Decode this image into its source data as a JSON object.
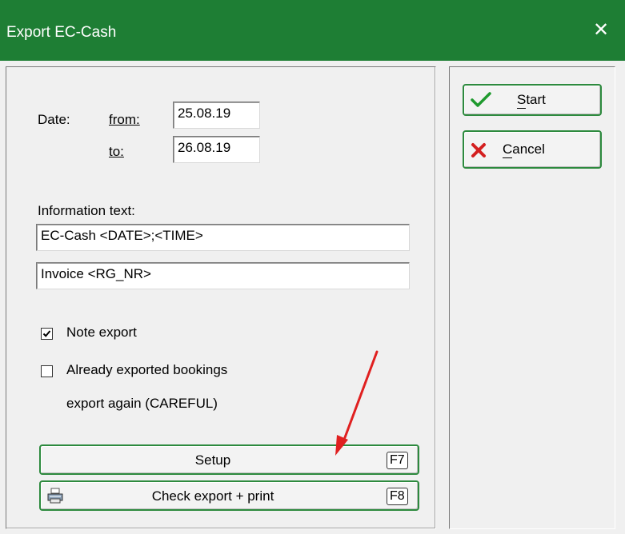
{
  "window": {
    "title": "Export EC-Cash"
  },
  "date": {
    "label": "Date:",
    "from_label": "from:",
    "to_label": "to:",
    "from_value": "25.08.19",
    "to_value": "26.08.19"
  },
  "info": {
    "label": "Information text:",
    "line1": "EC-Cash <DATE>;<TIME>",
    "line2": "Invoice <RG_NR>"
  },
  "options": {
    "note_export": {
      "label": "Note export",
      "checked": true
    },
    "already_exported": {
      "label_line1": "Already exported bookings",
      "label_line2": "export again (CAREFUL)",
      "checked": false
    }
  },
  "buttons": {
    "setup": {
      "label": "Setup",
      "key": "F7"
    },
    "check": {
      "label": "Check export + print",
      "key": "F8"
    },
    "start": {
      "label": "Start"
    },
    "cancel": {
      "label": "Cancel"
    }
  },
  "colors": {
    "titlebar": "#1e7e34",
    "button_border": "#2d8a3e",
    "annotation_arrow": "#e02020"
  }
}
